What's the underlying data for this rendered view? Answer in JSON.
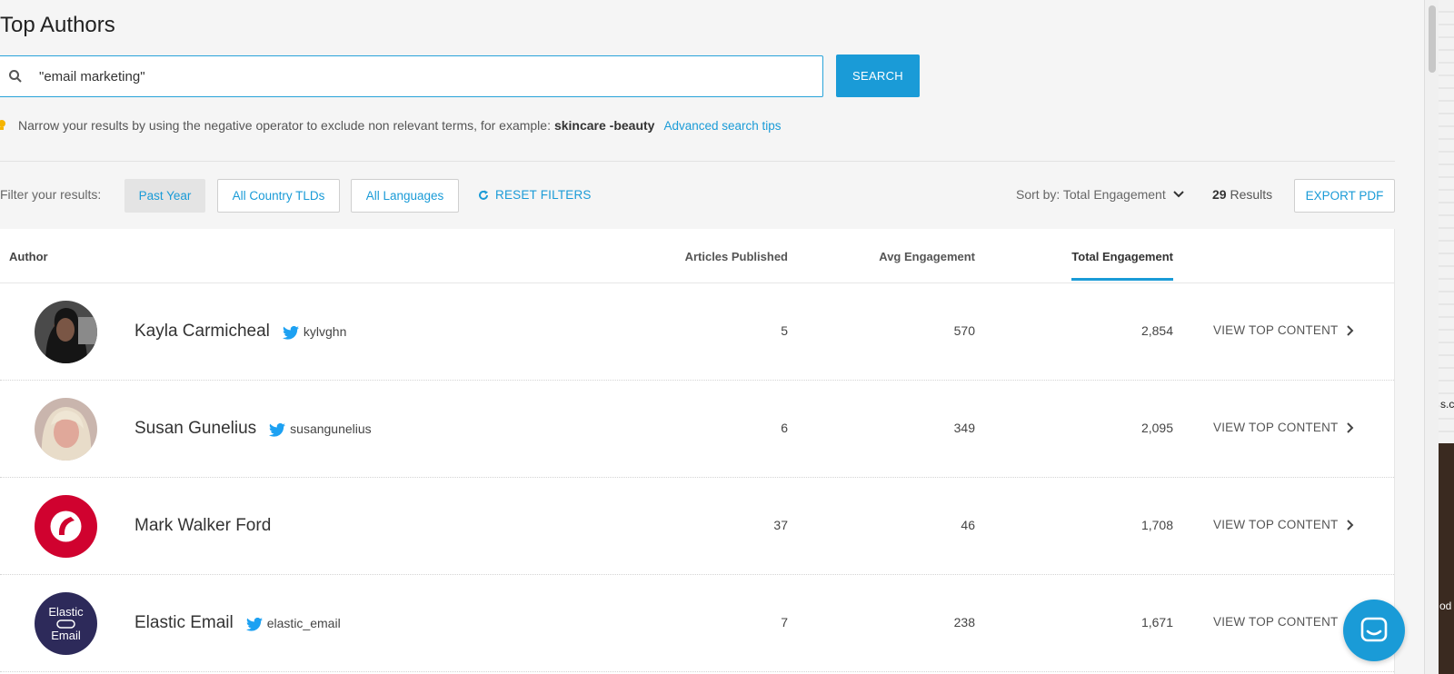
{
  "page": {
    "title": "Top Authors"
  },
  "search": {
    "value": "\"email marketing\"",
    "button_label": "SEARCH",
    "icon": "search-icon"
  },
  "tip": {
    "icon": "lightbulb-icon",
    "text": "Narrow your results by using the negative operator to exclude non relevant terms, for example:",
    "example": "skincare -beauty",
    "link": "Advanced search tips"
  },
  "filters": {
    "label": "Filter your results:",
    "chips": [
      {
        "label": "Past Year",
        "active": true
      },
      {
        "label": "All Country TLDs",
        "active": false
      },
      {
        "label": "All Languages",
        "active": false
      }
    ],
    "reset_label": "RESET FILTERS"
  },
  "sort": {
    "label": "Sort by: Total Engagement"
  },
  "results": {
    "count": "29",
    "label": "Results"
  },
  "export_label": "EXPORT PDF",
  "table": {
    "columns": {
      "author": "Author",
      "articles": "Articles Published",
      "avg": "Avg Engagement",
      "total": "Total Engagement"
    },
    "rows": [
      {
        "name": "Kayla Carmicheal",
        "handle": "kylvghn",
        "articles": "5",
        "avg": "570",
        "total": "2,854",
        "action": "VIEW TOP CONTENT"
      },
      {
        "name": "Susan Gunelius",
        "handle": "susangunelius",
        "articles": "6",
        "avg": "349",
        "total": "2,095",
        "action": "VIEW TOP CONTENT"
      },
      {
        "name": "Mark Walker Ford",
        "handle": "",
        "articles": "37",
        "avg": "46",
        "total": "1,708",
        "action": "VIEW TOP CONTENT"
      },
      {
        "name": "Elastic Email",
        "handle": "elastic_email",
        "articles": "7",
        "avg": "238",
        "total": "1,671",
        "action": "VIEW TOP CONTENT"
      }
    ]
  },
  "avatar4": {
    "line1": "Elastic",
    "line2": "Email"
  },
  "side": {
    "text": "s.c",
    "text2": "od"
  },
  "colors": {
    "accent": "#1a9bd7",
    "twitter": "#1da1f2"
  }
}
